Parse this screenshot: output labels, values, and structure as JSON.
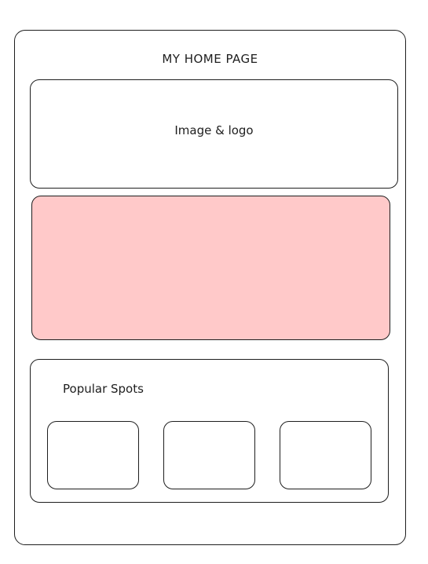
{
  "page": {
    "title": "MY HOME PAGE"
  },
  "hero": {
    "label": "Image & logo"
  },
  "banner": {
    "fill_color": "#ffc9c9"
  },
  "popular_spots": {
    "title": "Popular Spots",
    "cards": [
      {
        "label": ""
      },
      {
        "label": ""
      },
      {
        "label": ""
      }
    ]
  }
}
